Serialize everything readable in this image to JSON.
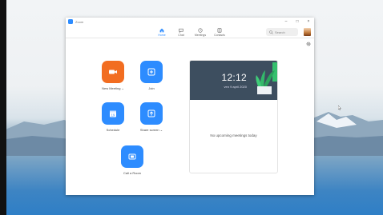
{
  "window": {
    "title": "Zoom"
  },
  "nav": {
    "tabs": [
      {
        "label": "Home",
        "icon": "home-icon",
        "active": true
      },
      {
        "label": "Chat",
        "icon": "chat-icon",
        "active": false
      },
      {
        "label": "Meetings",
        "icon": "clock-icon",
        "active": false
      },
      {
        "label": "Contacts",
        "icon": "contacts-icon",
        "active": false
      }
    ],
    "search_placeholder": "Search"
  },
  "actions": {
    "new_meeting": "New Meeting",
    "join": "Join",
    "schedule": "Schedule",
    "schedule_day": "19",
    "share_screen": "Share screen",
    "call_room": "Call a Room"
  },
  "card": {
    "time": "12:12",
    "date": "ven 9 april 2020",
    "empty_text": "No upcoming meetings today"
  },
  "colors": {
    "accent": "#2d8cff",
    "orange": "#f26d21",
    "card_header": "#3d4e5f"
  }
}
